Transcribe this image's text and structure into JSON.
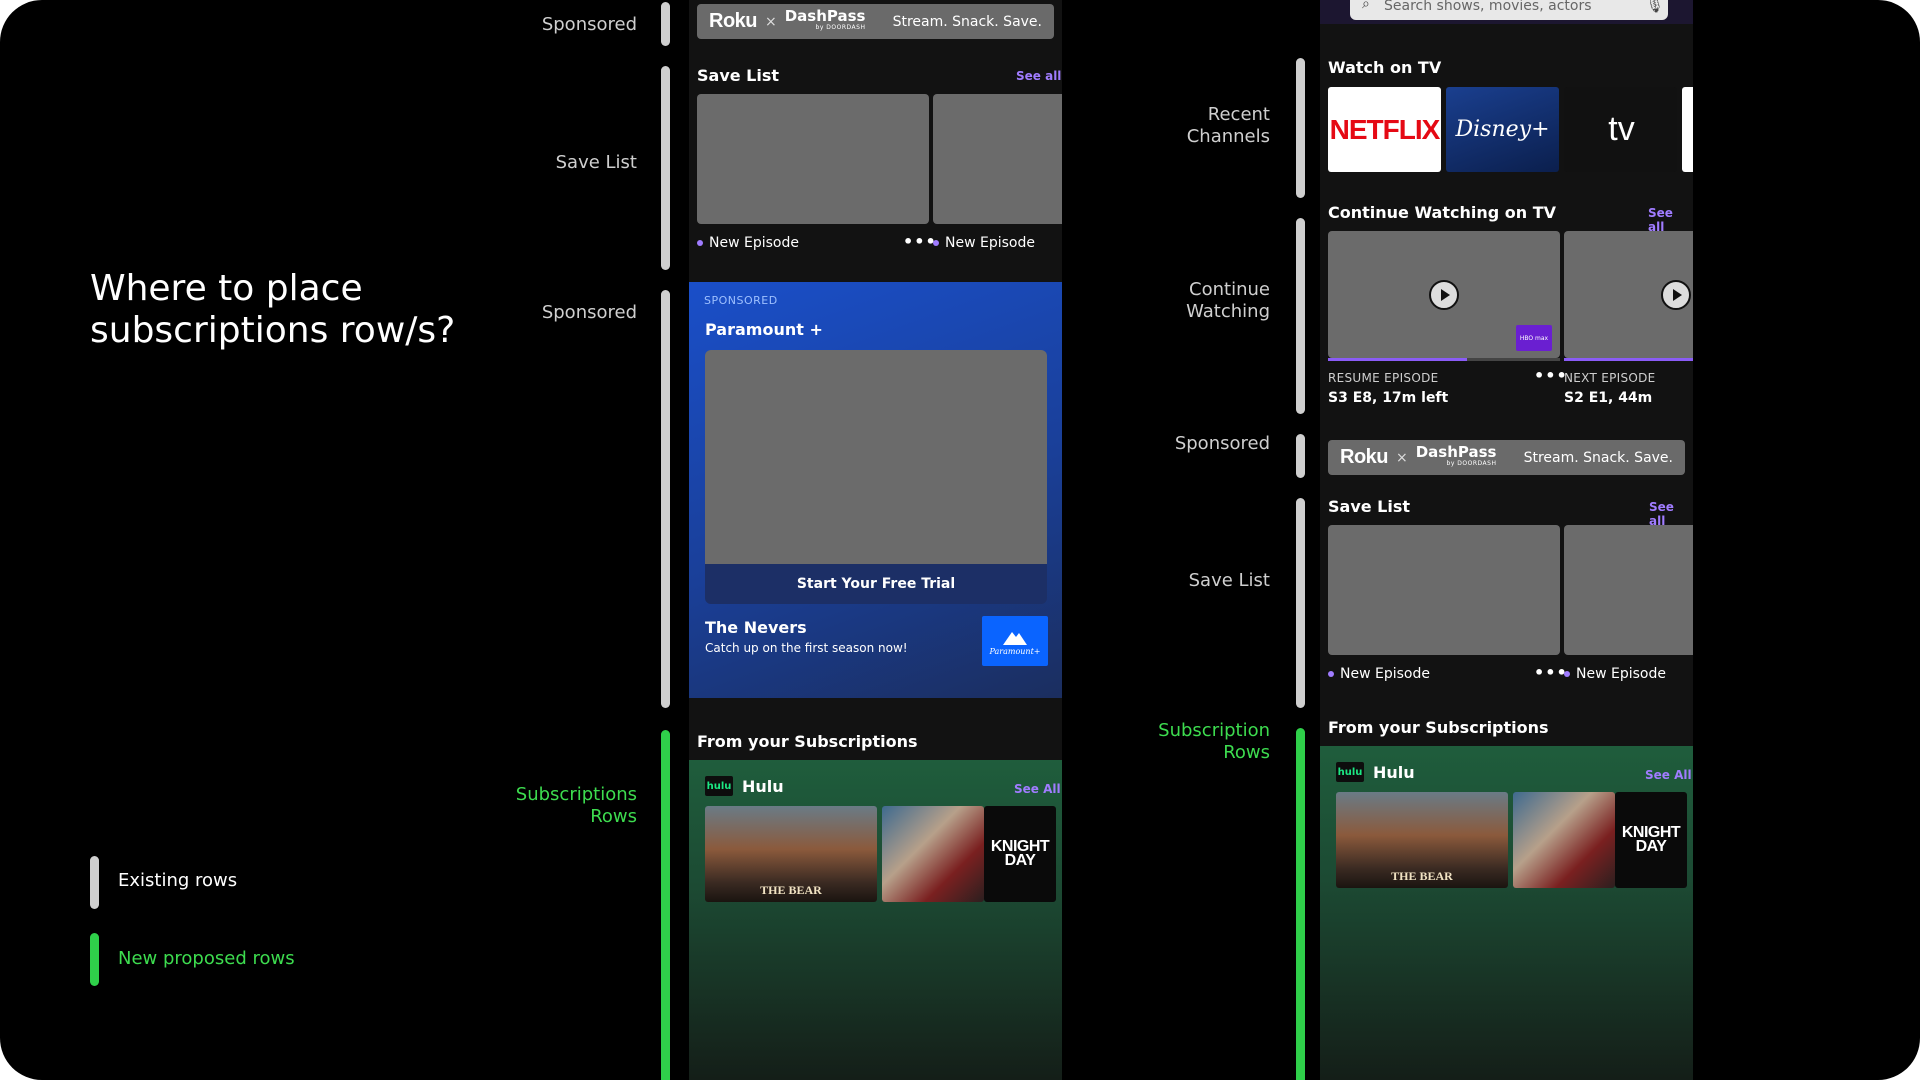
{
  "heading": "Where to place subscriptions row/s?",
  "legend": {
    "existing": {
      "label": "Existing rows",
      "color": "#cfcfcf"
    },
    "proposed": {
      "label": "New proposed rows",
      "color": "#2fd04a"
    }
  },
  "left_labels": {
    "sponsored_top": "Sponsored",
    "save_list": "Save List",
    "sponsored_mid": "Sponsored",
    "subscriptions": [
      "Subscriptions",
      "Rows"
    ]
  },
  "right_labels": {
    "recent_channels": [
      "Recent",
      "Channels"
    ],
    "continue_watching": [
      "Continue",
      "Watching"
    ],
    "sponsored": "Sponsored",
    "save_list": "Save List",
    "subscriptions": [
      "Subscription",
      "Rows"
    ]
  },
  "ad_banner": {
    "brand": "Roku",
    "times": "×",
    "partner": "DashPass",
    "partner_sub": "by DOORDASH",
    "tagline": "Stream. Snack. Save."
  },
  "phone_left": {
    "save_list": {
      "title": "Save List",
      "see_all": "See all",
      "items": [
        "New Episode",
        "New Episode"
      ],
      "more": "•••"
    },
    "sponsored_card": {
      "tag": "SPONSORED",
      "provider": "Paramount +",
      "cta": "Start Your Free Trial",
      "show_title": "The Nevers",
      "show_sub": "Catch up on the first season now!",
      "logo_text": "Paramount+"
    },
    "subscriptions": {
      "section_title": "From your Subscriptions",
      "service": "Hulu",
      "service_logo": "hulu",
      "see_all": "See All",
      "posters": [
        "THE BEAR",
        "KNIGHT DAY"
      ]
    }
  },
  "phone_right": {
    "search_placeholder": "Search shows, movies, actors",
    "watch_on_tv": {
      "title": "Watch on TV",
      "apps": [
        "NETFLIX",
        "Disney+",
        "tv"
      ]
    },
    "continue_watching": {
      "title": "Continue Watching on TV",
      "see_all": "See all",
      "items": [
        {
          "label": "RESUME EPISODE",
          "meta": "S3 E8, 17m left",
          "progress": 0.6,
          "badge": "HBO max"
        },
        {
          "label": "NEXT EPISODE",
          "meta": "S2 E1, 44m",
          "progress": 1.0
        }
      ],
      "more": "•••"
    },
    "save_list": {
      "title": "Save List",
      "see_all": "See all",
      "items": [
        "New Episode",
        "New Episode"
      ],
      "more": "•••"
    },
    "subscriptions": {
      "section_title": "From your Subscriptions",
      "service": "Hulu",
      "service_logo": "hulu",
      "see_all": "See All",
      "posters": [
        "THE BEAR",
        "KNIGHT DAY"
      ]
    }
  }
}
